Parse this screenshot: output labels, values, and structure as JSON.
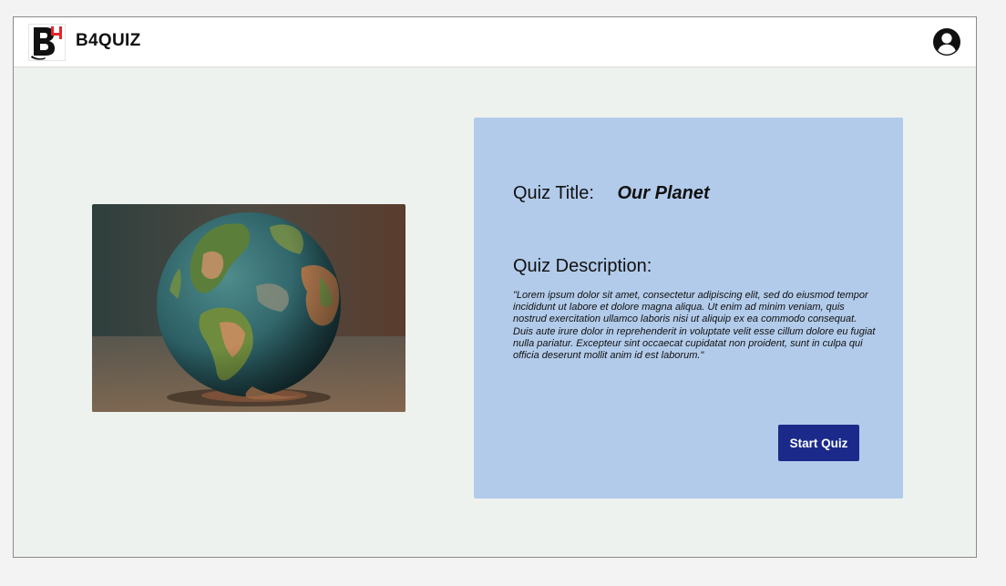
{
  "header": {
    "brand_name": "B4QUIZ",
    "logo_icon": "b4-logo",
    "account_icon": "account-circle-icon"
  },
  "quiz": {
    "title_label": "Quiz Title:",
    "title_value": "Our Planet",
    "description_label": "Quiz Description:",
    "description_text": "\"Lorem ipsum dolor sit amet, consectetur adipiscing elit, sed do eiusmod tempor incididunt ut labore et dolore magna aliqua. Ut enim ad minim veniam, quis nostrud exercitation ullamco laboris nisi ut aliquip ex ea commodo consequat. Duis aute irure dolor in reprehenderit in voluptate velit esse cillum dolore eu fugiat nulla pariatur. Excepteur sint occaecat cupidatat non proident, sunt in culpa qui officia deserunt mollit anim id est laborum.\"",
    "start_button_label": "Start Quiz",
    "image_subject": "globe-image"
  },
  "colors": {
    "page_background": "#eef2ee",
    "card_background": "#b2cbea",
    "button_background": "#1b2a8a",
    "logo_accent": "#e3262a"
  }
}
